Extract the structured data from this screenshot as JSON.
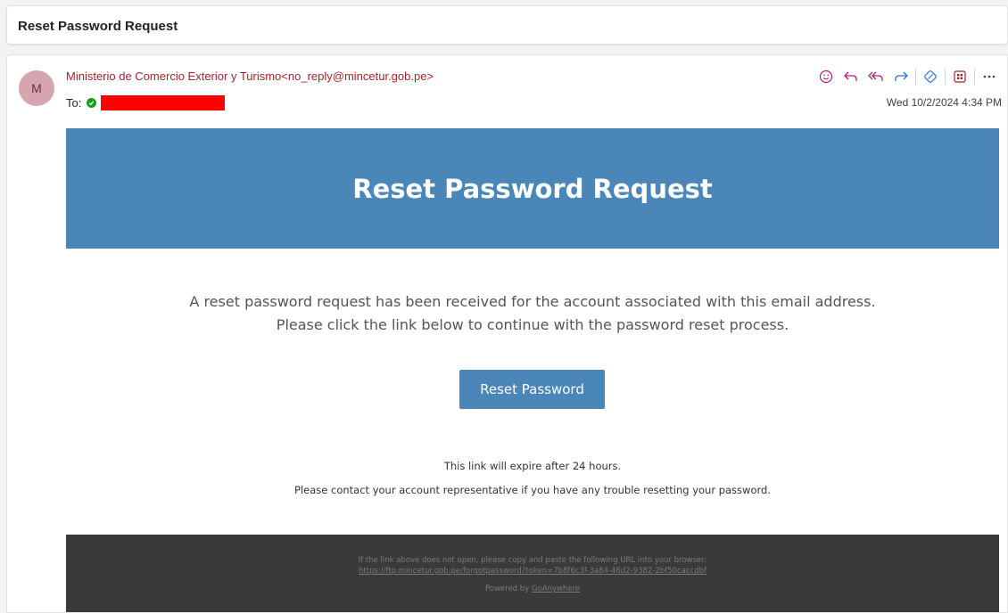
{
  "subject_bar": {
    "subject": "Reset Password Request"
  },
  "message": {
    "avatar_initial": "M",
    "sender": "Ministerio de Comercio Exterior y Turismo<no_reply@mincetur.gob.pe>",
    "to_label": "To:",
    "date": "Wed 10/2/2024 4:34 PM",
    "toolbar_icons": [
      "emoji-icon",
      "reply-icon",
      "reply-all-icon",
      "forward-icon",
      "loop-icon",
      "apps-icon",
      "more-icon"
    ]
  },
  "email": {
    "banner_title": "Reset Password Request",
    "body_line1": "A reset password request has been received for the account associated with this email address.",
    "body_line2": "Please click the link below to continue with the password reset process.",
    "button_label": "Reset Password",
    "expire_text": "This link will expire after 24 hours.",
    "contact_text": "Please contact your account representative if you have any trouble resetting your password.",
    "footer_line1": "If the link above does not open, please copy and paste the following URL into your browser:",
    "footer_url": "https://ftp.mincetur.gob.pe/forgotpassword?token=7b8f6c3f-3a84-46d2-9382-2bf50caccdbf",
    "footer_powered": "Powered by",
    "footer_brand": "GoAnywhere"
  },
  "colors": {
    "banner": "#4a86b8",
    "sender": "#a4262c",
    "footer": "#3a3a3a",
    "toolbar_icon": "#b4236e"
  }
}
